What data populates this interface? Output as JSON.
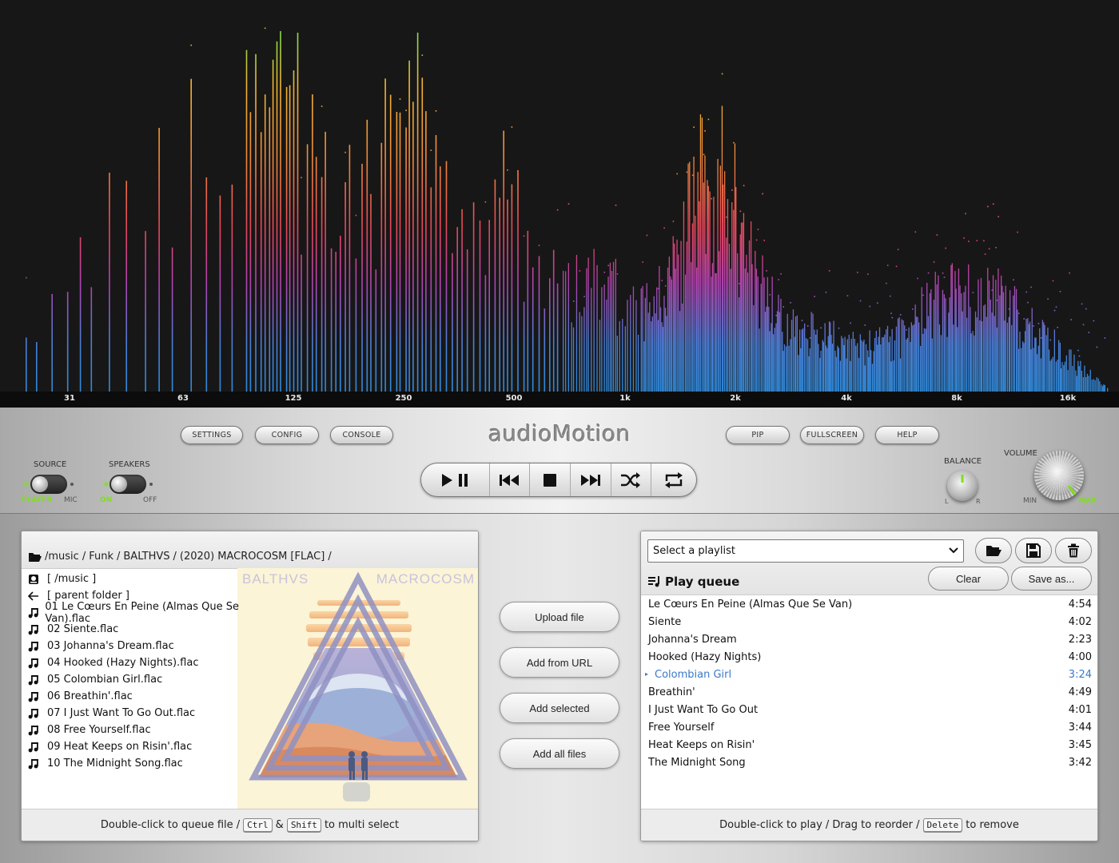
{
  "analyzer": {
    "scale_labels": [
      "31",
      "63",
      "125",
      "250",
      "500",
      "1k",
      "2k",
      "4k",
      "8k",
      "16k"
    ]
  },
  "controls": {
    "logo": "audioMotion",
    "left_buttons": [
      "SETTINGS",
      "CONFIG",
      "CONSOLE"
    ],
    "right_buttons": [
      "PIP",
      "FULLSCREEN",
      "HELP"
    ],
    "source": {
      "label": "SOURCE",
      "on": "PLAYER",
      "off": "MIC"
    },
    "speakers": {
      "label": "SPEAKERS",
      "on": "ON",
      "off": "OFF"
    },
    "balance": {
      "label": "BALANCE",
      "left": "L",
      "right": "R"
    },
    "volume": {
      "label": "VOLUME",
      "min": "MIN",
      "max": "MAX"
    },
    "transport_icons": [
      "play-pause-icon",
      "previous-icon",
      "stop-icon",
      "next-icon",
      "shuffle-icon",
      "repeat-icon"
    ]
  },
  "file_explorer": {
    "breadcrumb": [
      "/music",
      "Funk",
      "BALTHVS",
      "(2020) MACROCOSM [FLAC]"
    ],
    "breadcrumb_sep": "/",
    "items": [
      {
        "icon": "drive-icon",
        "name": "[ /music ]"
      },
      {
        "icon": "back-arrow-icon",
        "name": "[ parent folder ]"
      },
      {
        "icon": "music-note-icon",
        "name": "01 Le Cœurs En Peine (Almas Que Se Van).flac"
      },
      {
        "icon": "music-note-icon",
        "name": "02 Siente.flac"
      },
      {
        "icon": "music-note-icon",
        "name": "03 Johanna's Dream.flac"
      },
      {
        "icon": "music-note-icon",
        "name": "04 Hooked (Hazy Nights).flac"
      },
      {
        "icon": "music-note-icon",
        "name": "05 Colombian Girl.flac"
      },
      {
        "icon": "music-note-icon",
        "name": "06 Breathin'.flac"
      },
      {
        "icon": "music-note-icon",
        "name": "07 I Just Want To Go Out.flac"
      },
      {
        "icon": "music-note-icon",
        "name": "08 Free Yourself.flac"
      },
      {
        "icon": "music-note-icon",
        "name": "09 Heat Keeps on Risin'.flac"
      },
      {
        "icon": "music-note-icon",
        "name": "10 The Midnight Song.flac"
      }
    ],
    "cover": {
      "artist": "BALTHVS",
      "album": "MACROCOSM"
    },
    "footer": {
      "text1": "Double-click to queue file /",
      "key1": "Ctrl",
      "amp": "&",
      "key2": "Shift",
      "text2": "to multi select"
    }
  },
  "middle_buttons": [
    "Upload file",
    "Add from URL",
    "Add selected",
    "Add all files"
  ],
  "queue": {
    "select_placeholder": "Select a playlist",
    "title": "Play queue",
    "clear": "Clear",
    "save_as": "Save as...",
    "items": [
      {
        "title": "Le Cœurs En Peine (Almas Que Se Van)",
        "duration": "4:54"
      },
      {
        "title": "Siente",
        "duration": "4:02"
      },
      {
        "title": "Johanna's Dream",
        "duration": "2:23"
      },
      {
        "title": "Hooked (Hazy Nights)",
        "duration": "4:00"
      },
      {
        "title": "Colombian Girl",
        "duration": "3:24"
      },
      {
        "title": "Breathin'",
        "duration": "4:49"
      },
      {
        "title": "I Just Want To Go Out",
        "duration": "4:01"
      },
      {
        "title": "Free Yourself",
        "duration": "3:44"
      },
      {
        "title": "Heat Keeps on Risin'",
        "duration": "3:45"
      },
      {
        "title": "The Midnight Song",
        "duration": "3:42"
      }
    ],
    "current_index": 4,
    "footer": {
      "text1": "Double-click to play / Drag to reorder /",
      "key": "Delete",
      "text2": "to remove"
    }
  },
  "colors": {
    "accent_green": "#7ee01a",
    "current_track": "#3a79c9"
  }
}
